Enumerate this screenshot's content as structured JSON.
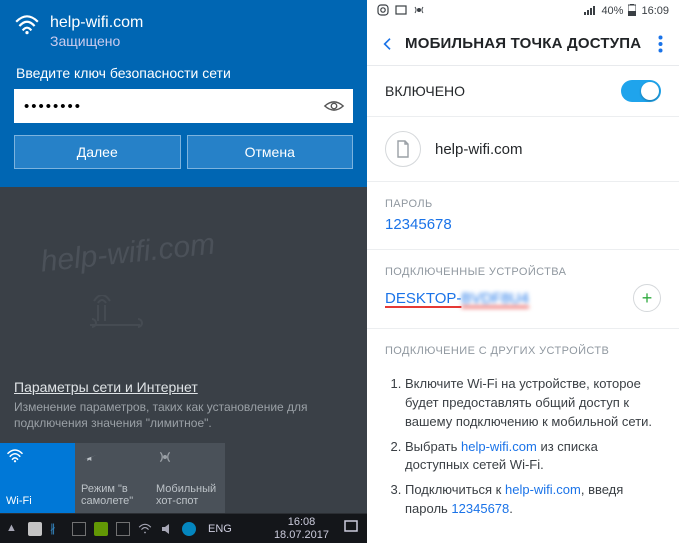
{
  "left": {
    "ssid": "help-wifi.com",
    "status": "Защищено",
    "prompt": "Введите ключ безопасности сети",
    "password_mask": "••••••••",
    "btn_next": "Далее",
    "btn_cancel": "Отмена",
    "watermark": "help-wifi.com",
    "net_settings": {
      "link": "Параметры сети и Интернет",
      "desc": "Изменение параметров, таких как установление для подключения значения \"лимитное\"."
    },
    "tiles": {
      "wifi": "Wi-Fi",
      "airplane_l1": "Режим \"в",
      "airplane_l2": "самолете\"",
      "hotspot_l1": "Мобильный",
      "hotspot_l2": "хот-спот"
    },
    "taskbar": {
      "lang": "ENG",
      "time": "16:08",
      "date": "18.07.2017"
    }
  },
  "right": {
    "status": {
      "battery": "40%",
      "clock": "16:09"
    },
    "appbar": {
      "title": "МОБИЛЬНАЯ ТОЧКА ДОСТУПА"
    },
    "enabled_label": "ВКЛЮЧЕНО",
    "ssid": "help-wifi.com",
    "password_label": "ПАРОЛЬ",
    "password_value": "12345678",
    "devices_label": "ПОДКЛЮЧЕННЫЕ УСТРОЙСТВА",
    "device_prefix": "DESKTOP-",
    "device_suffix": "BVDF8U4",
    "other_label": "ПОДКЛЮЧЕНИЕ С ДРУГИХ УСТРОЙСТВ",
    "steps": {
      "s1a": "Включите Wi-Fi на устройстве, которое будет предоставлять общий доступ к вашему подключению к мобильной сети.",
      "s2a": "Выбрать ",
      "s2b": "help-wifi.com",
      "s2c": " из списка доступных сетей Wi-Fi.",
      "s3a": "Подключиться к ",
      "s3b": "help-wifi.com",
      "s3c": ", введя пароль ",
      "s3d": "12345678",
      "s3e": "."
    }
  }
}
